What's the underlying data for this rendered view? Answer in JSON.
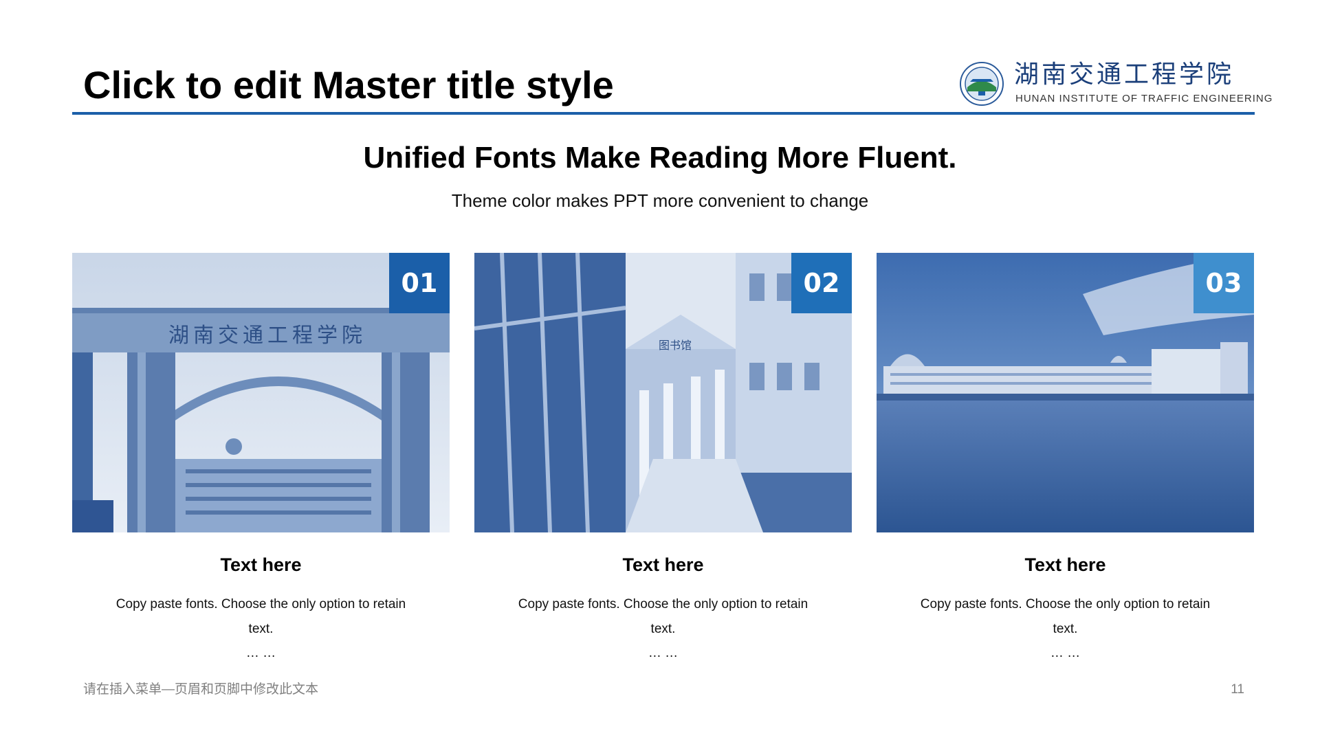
{
  "header": {
    "title": "Click to edit Master title style",
    "logo_cn": "湖南交通工程学院",
    "logo_en": "HUNAN INSTITUTE OF TRAFFIC ENGINEERING"
  },
  "headline": "Unified Fonts Make Reading More Fluent.",
  "subline": "Theme color makes PPT more convenient to change",
  "cards": [
    {
      "number": "01",
      "title": "Text here",
      "body": "Copy paste fonts. Choose the only option to retain text.",
      "ellipsis": "… …",
      "badge_color": "#1b5fa9",
      "photo_text": "湖南交通工程学院"
    },
    {
      "number": "02",
      "title": "Text here",
      "body": "Copy paste fonts. Choose the only option to retain text.",
      "ellipsis": "… …",
      "badge_color": "#1f6fb8",
      "photo_text": "图书馆"
    },
    {
      "number": "03",
      "title": "Text here",
      "body": "Copy paste fonts. Choose the only option to retain text.",
      "ellipsis": "… …",
      "badge_color": "#3f8fce"
    }
  ],
  "footer": {
    "text": "请在插入菜单—页眉和页脚中修改此文本",
    "page_number": "11"
  },
  "colors": {
    "accent": "#1b5fa9",
    "footer_text": "#7f7f7f"
  }
}
